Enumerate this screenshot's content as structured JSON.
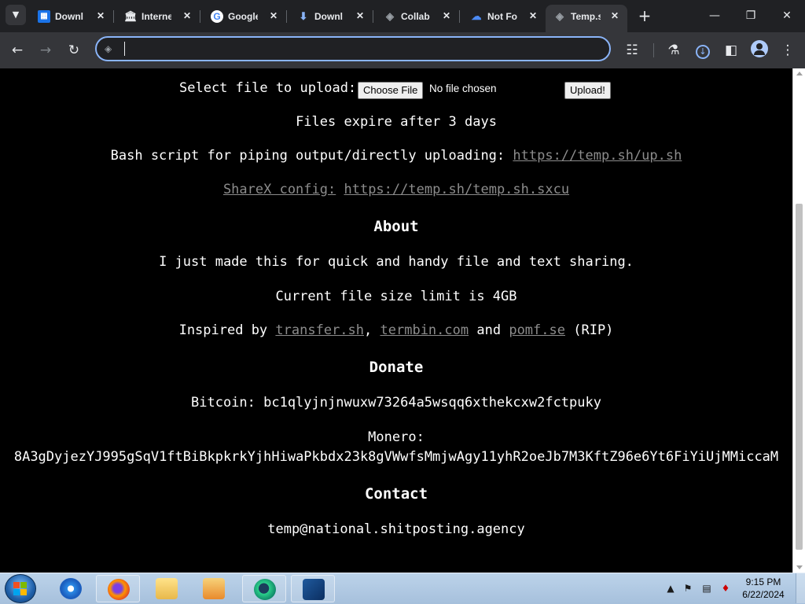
{
  "browser": {
    "tabs": [
      {
        "title": "Downl",
        "icon": "download-page-icon",
        "active": false
      },
      {
        "title": "Interne",
        "icon": "internet-archive-icon",
        "active": false
      },
      {
        "title": "Google",
        "icon": "google-icon",
        "active": false
      },
      {
        "title": "Downl",
        "icon": "download-arrow-icon",
        "active": false
      },
      {
        "title": "Collab",
        "icon": "globe-icon",
        "active": false
      },
      {
        "title": "Not Fo",
        "icon": "cloud-icon",
        "active": false
      },
      {
        "title": "Temp.s",
        "icon": "globe-icon",
        "active": true
      }
    ],
    "address_bar": {
      "value": ""
    },
    "colors": {
      "tabstrip": "#202124",
      "toolbar": "#35363a",
      "omnibox_focus": "#8ab4f8"
    }
  },
  "page": {
    "upload_label": "Select file to upload:",
    "choose_file_label": "Choose File",
    "no_file_text": "No file chosen",
    "upload_button": "Upload!",
    "expire_text": "Files expire after 3 days",
    "bash_text": "Bash script for piping output/directly uploading:",
    "bash_link": "https://temp.sh/up.sh",
    "sharex_label": "ShareX config:",
    "sharex_link": "https://temp.sh/temp.sh.sxcu",
    "about_heading": "About",
    "about_text": "I just made this for quick and handy file and text sharing.",
    "size_limit_text": "Current file size limit is 4GB",
    "inspired_prefix": "Inspired by",
    "inspired_link1": "transfer.sh",
    "inspired_sep1": ",",
    "inspired_link2": "termbin.com",
    "inspired_and": "and",
    "inspired_link3": "pomf.se",
    "inspired_suffix": "(RIP)",
    "donate_heading": "Donate",
    "bitcoin_text": "Bitcoin: bc1qlyjnjnwuxw73264a5wsqq6xthekcxw2fctpuky",
    "monero_label": "Monero:",
    "monero_address": "8A3gDyjezYJ995gSqV1ftBiBkpkrkYjhHiwaPkbdx23k8gVWwfsMmjwAgy11yhR2oeJb7M3KftZ96e6Yt6FiYiUjMMiccaM",
    "contact_heading": "Contact",
    "contact_email": "temp@national.shitposting.agency",
    "colors": {
      "background": "#000000",
      "text": "#ffffff",
      "link": "#8c8c8c"
    }
  },
  "taskbar": {
    "apps": [
      {
        "name": "internet-explorer",
        "pinned": false
      },
      {
        "name": "firefox",
        "pinned": true
      },
      {
        "name": "file-explorer",
        "pinned": false
      },
      {
        "name": "media-player",
        "pinned": false
      },
      {
        "name": "browser-app",
        "pinned": true
      },
      {
        "name": "virtualbox",
        "pinned": true
      }
    ],
    "time": "9:15 PM",
    "date": "6/22/2024"
  }
}
